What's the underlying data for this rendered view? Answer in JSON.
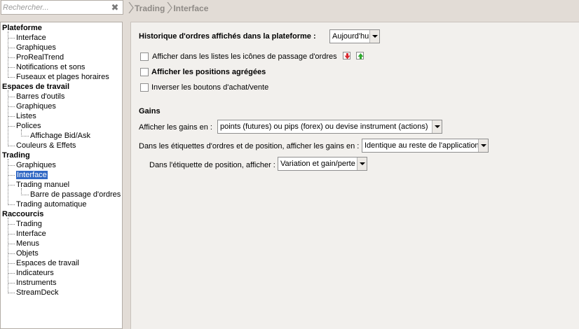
{
  "search": {
    "placeholder": "Rechercher...",
    "clear_icon": "close-icon"
  },
  "breadcrumb": [
    "Trading",
    "Interface"
  ],
  "tree": [
    {
      "label": "Plateforme",
      "type": "category"
    },
    {
      "label": "Interface",
      "type": "item"
    },
    {
      "label": "Graphiques",
      "type": "item"
    },
    {
      "label": "ProRealTrend",
      "type": "item"
    },
    {
      "label": "Notifications et sons",
      "type": "item"
    },
    {
      "label": "Fuseaux et plages horaires",
      "type": "item"
    },
    {
      "label": "Espaces de travail",
      "type": "category"
    },
    {
      "label": "Barres d'outils",
      "type": "item"
    },
    {
      "label": "Graphiques",
      "type": "item"
    },
    {
      "label": "Listes",
      "type": "item"
    },
    {
      "label": "Polices",
      "type": "item"
    },
    {
      "label": "Affichage Bid/Ask",
      "type": "sub"
    },
    {
      "label": "Couleurs & Effets",
      "type": "item"
    },
    {
      "label": "Trading",
      "type": "category"
    },
    {
      "label": "Graphiques",
      "type": "item"
    },
    {
      "label": "Interface",
      "type": "item",
      "selected": true
    },
    {
      "label": "Trading manuel",
      "type": "item"
    },
    {
      "label": "Barre de passage d'ordres",
      "type": "sub"
    },
    {
      "label": "Trading automatique",
      "type": "item"
    },
    {
      "label": "Raccourcis",
      "type": "category"
    },
    {
      "label": "Trading",
      "type": "item"
    },
    {
      "label": "Interface",
      "type": "item"
    },
    {
      "label": "Menus",
      "type": "item"
    },
    {
      "label": "Objets",
      "type": "item"
    },
    {
      "label": "Espaces de travail",
      "type": "item"
    },
    {
      "label": "Indicateurs",
      "type": "item"
    },
    {
      "label": "Instruments",
      "type": "item"
    },
    {
      "label": "StreamDeck",
      "type": "item"
    }
  ],
  "main": {
    "history_label": "Historique d'ordres affichés dans la plateforme :",
    "history_value": "Aujourd'hui",
    "checkboxes": [
      {
        "label": "Afficher dans les listes les icônes de passage d'ordres",
        "checked": false,
        "icons": [
          "sell-order-icon",
          "buy-order-icon"
        ]
      },
      {
        "label": "Afficher les positions agrégées",
        "checked": false,
        "bold": true
      },
      {
        "label": "Inverser les boutons d'achat/vente",
        "checked": false
      }
    ],
    "gains": {
      "title": "Gains",
      "show_gains_label": "Afficher les gains en :",
      "show_gains_value": "points (futures) ou pips (forex) ou devise instrument (actions)",
      "labels_gains_label": "Dans les étiquettes d'ordres et de position, afficher les gains en :",
      "labels_gains_value": "Identique au reste de l'application",
      "position_label_label": "Dans l'étiquette de position, afficher :",
      "position_label_value": "Variation et gain/perte"
    }
  },
  "colors": {
    "selection": "#3168c4",
    "panel": "#f2f0ed",
    "background": "#e2dcd6",
    "sell_arrow": "#d8282f",
    "buy_arrow": "#2fa82f"
  }
}
